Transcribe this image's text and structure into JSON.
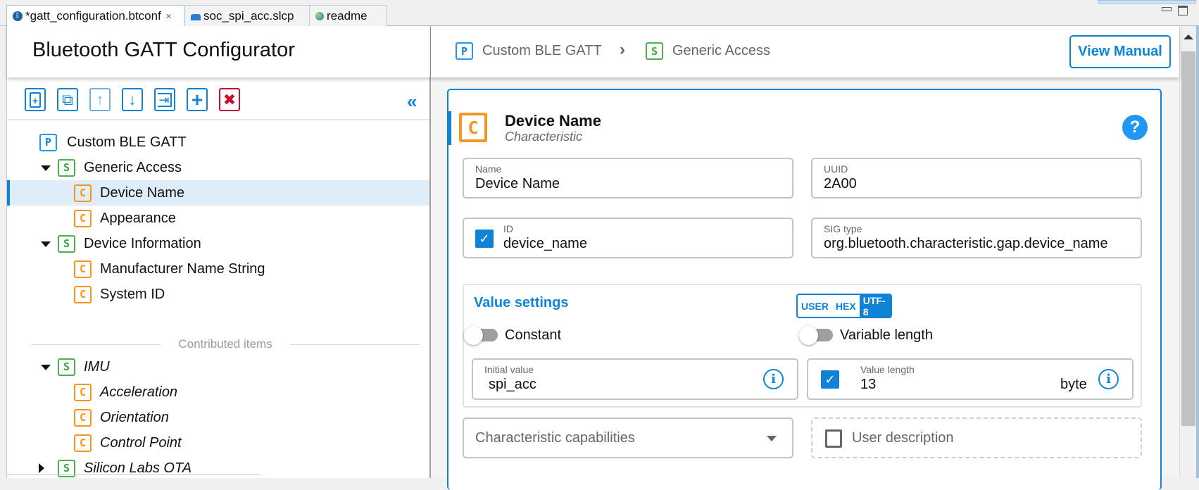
{
  "tabs": [
    {
      "label": "*gatt_configuration.btconf",
      "icon": "bluetooth-icon",
      "active": true,
      "closable": true
    },
    {
      "label": "soc_spi_acc.slcp",
      "icon": "project-icon",
      "active": false
    },
    {
      "label": "readme",
      "icon": "globe-icon",
      "active": false
    }
  ],
  "tab_close_glyph": "✕",
  "app_title": "Bluetooth GATT Configurator",
  "toolbar": {
    "buttons": [
      {
        "name": "add-item-button",
        "icon": "file-plus-icon",
        "glyph": "+"
      },
      {
        "name": "duplicate-button",
        "icon": "copy-icon",
        "glyph": "⧉"
      },
      {
        "name": "move-up-button",
        "icon": "arrow-up-icon",
        "glyph": "↑"
      },
      {
        "name": "move-down-button",
        "icon": "arrow-down-icon",
        "glyph": "↓"
      },
      {
        "name": "import-button",
        "icon": "import-icon",
        "glyph": "⇥"
      },
      {
        "name": "add-button",
        "icon": "plus-icon",
        "glyph": "+"
      },
      {
        "name": "delete-button",
        "icon": "close-icon",
        "glyph": "✖"
      }
    ],
    "collapse_glyph": "«"
  },
  "tree": {
    "items": [
      {
        "type": "P",
        "label": "Custom BLE GATT",
        "level": 0,
        "expander": null
      },
      {
        "type": "S",
        "label": "Generic Access",
        "level": 1,
        "expander": "down"
      },
      {
        "type": "C",
        "label": "Device Name",
        "level": 2,
        "selected": true
      },
      {
        "type": "C",
        "label": "Appearance",
        "level": 2
      },
      {
        "type": "S",
        "label": "Device Information",
        "level": 1,
        "expander": "down"
      },
      {
        "type": "C",
        "label": "Manufacturer Name String",
        "level": 2
      },
      {
        "type": "C",
        "label": "System ID",
        "level": 2
      }
    ],
    "contributed_label": "Contributed items",
    "contributed": [
      {
        "type": "S",
        "label": "IMU",
        "level": 1,
        "expander": "down"
      },
      {
        "type": "C",
        "label": "Acceleration",
        "level": 2
      },
      {
        "type": "C",
        "label": "Orientation",
        "level": 2
      },
      {
        "type": "C",
        "label": "Control Point",
        "level": 2
      },
      {
        "type": "S",
        "label": "Silicon Labs OTA",
        "level": 1,
        "expander": "right"
      }
    ]
  },
  "breadcrumb": [
    {
      "type": "P",
      "label": "Custom BLE GATT"
    },
    {
      "type": "S",
      "label": "Generic Access"
    }
  ],
  "breadcrumb_sep": "›",
  "view_manual_label": "View Manual",
  "card": {
    "type_badge": "C",
    "title": "Device Name",
    "subtitle": "Characteristic",
    "help_glyph": "?",
    "name": {
      "label": "Name",
      "value": "Device Name"
    },
    "uuid": {
      "label": "UUID",
      "value": "2A00"
    },
    "id": {
      "label": "ID",
      "value": "device_name",
      "checked": true
    },
    "sig_type": {
      "label": "SIG type",
      "value": "org.bluetooth.characteristic.gap.device_name"
    },
    "value_settings": {
      "title": "Value settings",
      "formats": [
        "USER",
        "HEX",
        "UTF-8"
      ],
      "selected_format": "UTF-8",
      "constant": {
        "label": "Constant",
        "on": false
      },
      "variable_length": {
        "label": "Variable length",
        "on": false
      },
      "initial_value": {
        "label": "Initial value",
        "value": "spi_acc"
      },
      "value_length": {
        "label": "Value length",
        "value": "13",
        "unit": "byte",
        "checked": true
      }
    },
    "capabilities": {
      "placeholder": "Characteristic capabilities"
    },
    "user_description": {
      "label": "User description",
      "checked": false
    }
  },
  "check_glyph": "✓",
  "info_glyph": "i"
}
